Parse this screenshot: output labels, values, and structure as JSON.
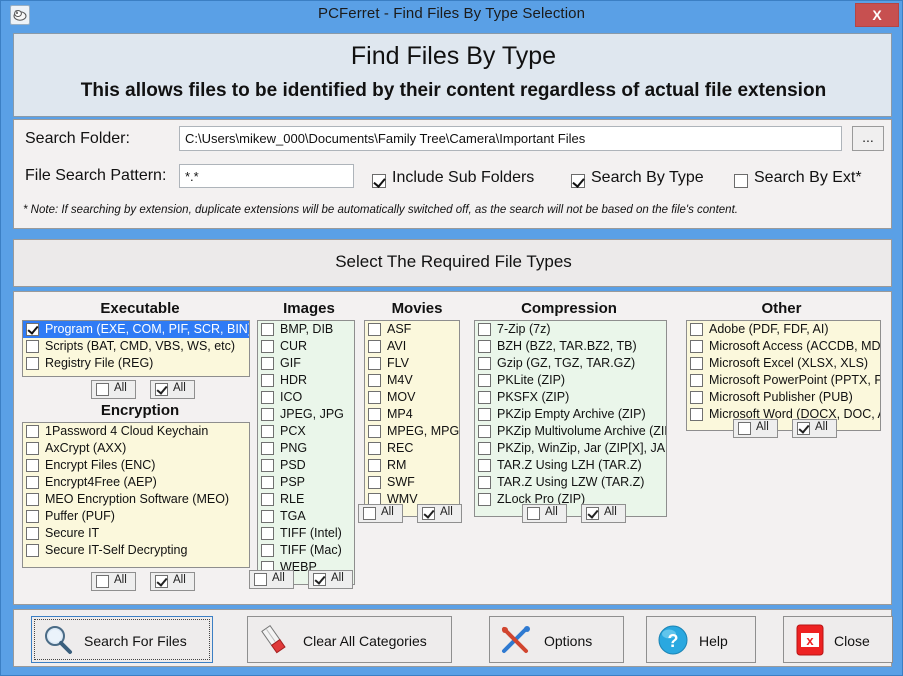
{
  "window": {
    "title": "PCFerret - Find Files By Type Selection",
    "app_icon": "ferret-icon",
    "close_label": "X"
  },
  "header": {
    "title": "Find Files By Type",
    "subtitle": "This allows files to be identified by their content regardless of actual file extension"
  },
  "search": {
    "folder_label": "Search Folder:",
    "folder_value": "C:\\Users\\mikew_000\\Documents\\Family Tree\\Camera\\Important Files",
    "browse_label": "...",
    "pattern_label": "File Search Pattern:",
    "pattern_value": "*.*",
    "options": [
      {
        "label": "Include Sub Folders",
        "checked": true
      },
      {
        "label": "Search By Type",
        "checked": true
      },
      {
        "label": "Search By Ext*",
        "checked": false
      }
    ],
    "note": "* Note: If searching by extension, duplicate extensions will be automatically switched off, as the search will not be based on the file's content."
  },
  "select_band": {
    "title": "Select The Required File Types"
  },
  "all_buttons": {
    "uncheck_label": "All",
    "check_label": "All"
  },
  "categories": [
    {
      "name": "Executable",
      "bg": "#fbf8dc",
      "items": [
        {
          "label": "Program (EXE, COM, PIF, SCR, BIN)",
          "checked": true,
          "selected": true
        },
        {
          "label": "Scripts (BAT, CMD, VBS, WS, etc)",
          "checked": false,
          "selected": false
        },
        {
          "label": "Registry File (REG)",
          "checked": false,
          "selected": false
        }
      ]
    },
    {
      "name": "Encryption",
      "bg": "#fbf8dc",
      "items": [
        {
          "label": "1Password 4 Cloud Keychain",
          "checked": false,
          "selected": false
        },
        {
          "label": "AxCrypt (AXX)",
          "checked": false,
          "selected": false
        },
        {
          "label": "Encrypt Files (ENC)",
          "checked": false,
          "selected": false
        },
        {
          "label": "Encrypt4Free (AEP)",
          "checked": false,
          "selected": false
        },
        {
          "label": "MEO Encryption Software (MEO)",
          "checked": false,
          "selected": false
        },
        {
          "label": "Puffer (PUF)",
          "checked": false,
          "selected": false
        },
        {
          "label": "Secure IT",
          "checked": false,
          "selected": false
        },
        {
          "label": "Secure IT-Self Decrypting",
          "checked": false,
          "selected": false
        }
      ]
    },
    {
      "name": "Images",
      "bg": "#eaf6ea",
      "items": [
        {
          "label": "BMP, DIB",
          "checked": false,
          "selected": false
        },
        {
          "label": "CUR",
          "checked": false,
          "selected": false
        },
        {
          "label": "GIF",
          "checked": false,
          "selected": false
        },
        {
          "label": "HDR",
          "checked": false,
          "selected": false
        },
        {
          "label": "ICO",
          "checked": false,
          "selected": false
        },
        {
          "label": "JPEG, JPG",
          "checked": false,
          "selected": false
        },
        {
          "label": "PCX",
          "checked": false,
          "selected": false
        },
        {
          "label": "PNG",
          "checked": false,
          "selected": false
        },
        {
          "label": "PSD",
          "checked": false,
          "selected": false
        },
        {
          "label": "PSP",
          "checked": false,
          "selected": false
        },
        {
          "label": "RLE",
          "checked": false,
          "selected": false
        },
        {
          "label": "TGA",
          "checked": false,
          "selected": false
        },
        {
          "label": "TIFF (Intel)",
          "checked": false,
          "selected": false
        },
        {
          "label": "TIFF (Mac)",
          "checked": false,
          "selected": false
        },
        {
          "label": "WEBP",
          "checked": false,
          "selected": false
        }
      ]
    },
    {
      "name": "Movies",
      "bg": "#fbf8dc",
      "items": [
        {
          "label": "ASF",
          "checked": false,
          "selected": false
        },
        {
          "label": "AVI",
          "checked": false,
          "selected": false
        },
        {
          "label": "FLV",
          "checked": false,
          "selected": false
        },
        {
          "label": "M4V",
          "checked": false,
          "selected": false
        },
        {
          "label": "MOV",
          "checked": false,
          "selected": false
        },
        {
          "label": "MP4",
          "checked": false,
          "selected": false
        },
        {
          "label": "MPEG, MPG",
          "checked": false,
          "selected": false
        },
        {
          "label": "REC",
          "checked": false,
          "selected": false
        },
        {
          "label": "RM",
          "checked": false,
          "selected": false
        },
        {
          "label": "SWF",
          "checked": false,
          "selected": false
        },
        {
          "label": "WMV",
          "checked": false,
          "selected": false
        }
      ]
    },
    {
      "name": "Compression",
      "bg": "#eaf6ea",
      "items": [
        {
          "label": "7-Zip (7z)",
          "checked": false,
          "selected": false
        },
        {
          "label": "BZH (BZ2, TAR.BZ2, TB)",
          "checked": false,
          "selected": false
        },
        {
          "label": "Gzip (GZ, TGZ, TAR.GZ)",
          "checked": false,
          "selected": false
        },
        {
          "label": "PKLite (ZIP)",
          "checked": false,
          "selected": false
        },
        {
          "label": "PKSFX (ZIP)",
          "checked": false,
          "selected": false
        },
        {
          "label": "PKZip Empty Archive (ZIP)",
          "checked": false,
          "selected": false
        },
        {
          "label": "PKZip Multivolume Archive (ZIP)",
          "checked": false,
          "selected": false
        },
        {
          "label": "PKZip, WinZip, Jar (ZIP[X], JAR)",
          "checked": false,
          "selected": false
        },
        {
          "label": "TAR.Z Using LZH (TAR.Z)",
          "checked": false,
          "selected": false
        },
        {
          "label": "TAR.Z Using LZW (TAR.Z)",
          "checked": false,
          "selected": false
        },
        {
          "label": "ZLock Pro (ZIP)",
          "checked": false,
          "selected": false
        }
      ]
    },
    {
      "name": "Other",
      "bg": "#fbf8dc",
      "items": [
        {
          "label": "Adobe (PDF, FDF, AI)",
          "checked": false,
          "selected": false
        },
        {
          "label": "Microsoft Access (ACCDB, MDB)",
          "checked": false,
          "selected": false
        },
        {
          "label": "Microsoft Excel (XLSX, XLS)",
          "checked": false,
          "selected": false
        },
        {
          "label": "Microsoft PowerPoint (PPTX, PPT)",
          "checked": false,
          "selected": false
        },
        {
          "label": "Microsoft Publisher (PUB)",
          "checked": false,
          "selected": false
        },
        {
          "label": "Microsoft Word (DOCX, DOC, ASD)",
          "checked": false,
          "selected": false
        }
      ]
    }
  ],
  "buttons": [
    {
      "label": "Search For Files",
      "icon": "magnifier-icon",
      "focused": true
    },
    {
      "label": "Clear All Categories",
      "icon": "eraser-icon",
      "focused": false
    },
    {
      "label": "Options",
      "icon": "tools-icon",
      "focused": false
    },
    {
      "label": "Help",
      "icon": "question-icon",
      "focused": false
    },
    {
      "label": "Close",
      "icon": "close-red-icon",
      "focused": false
    }
  ],
  "colors": {
    "titlebar": "#5aa0e6",
    "close_red": "#c75050",
    "selection_blue": "#2f7bf5",
    "list_yellow": "#fbf8dc",
    "list_green": "#eaf6ea"
  }
}
